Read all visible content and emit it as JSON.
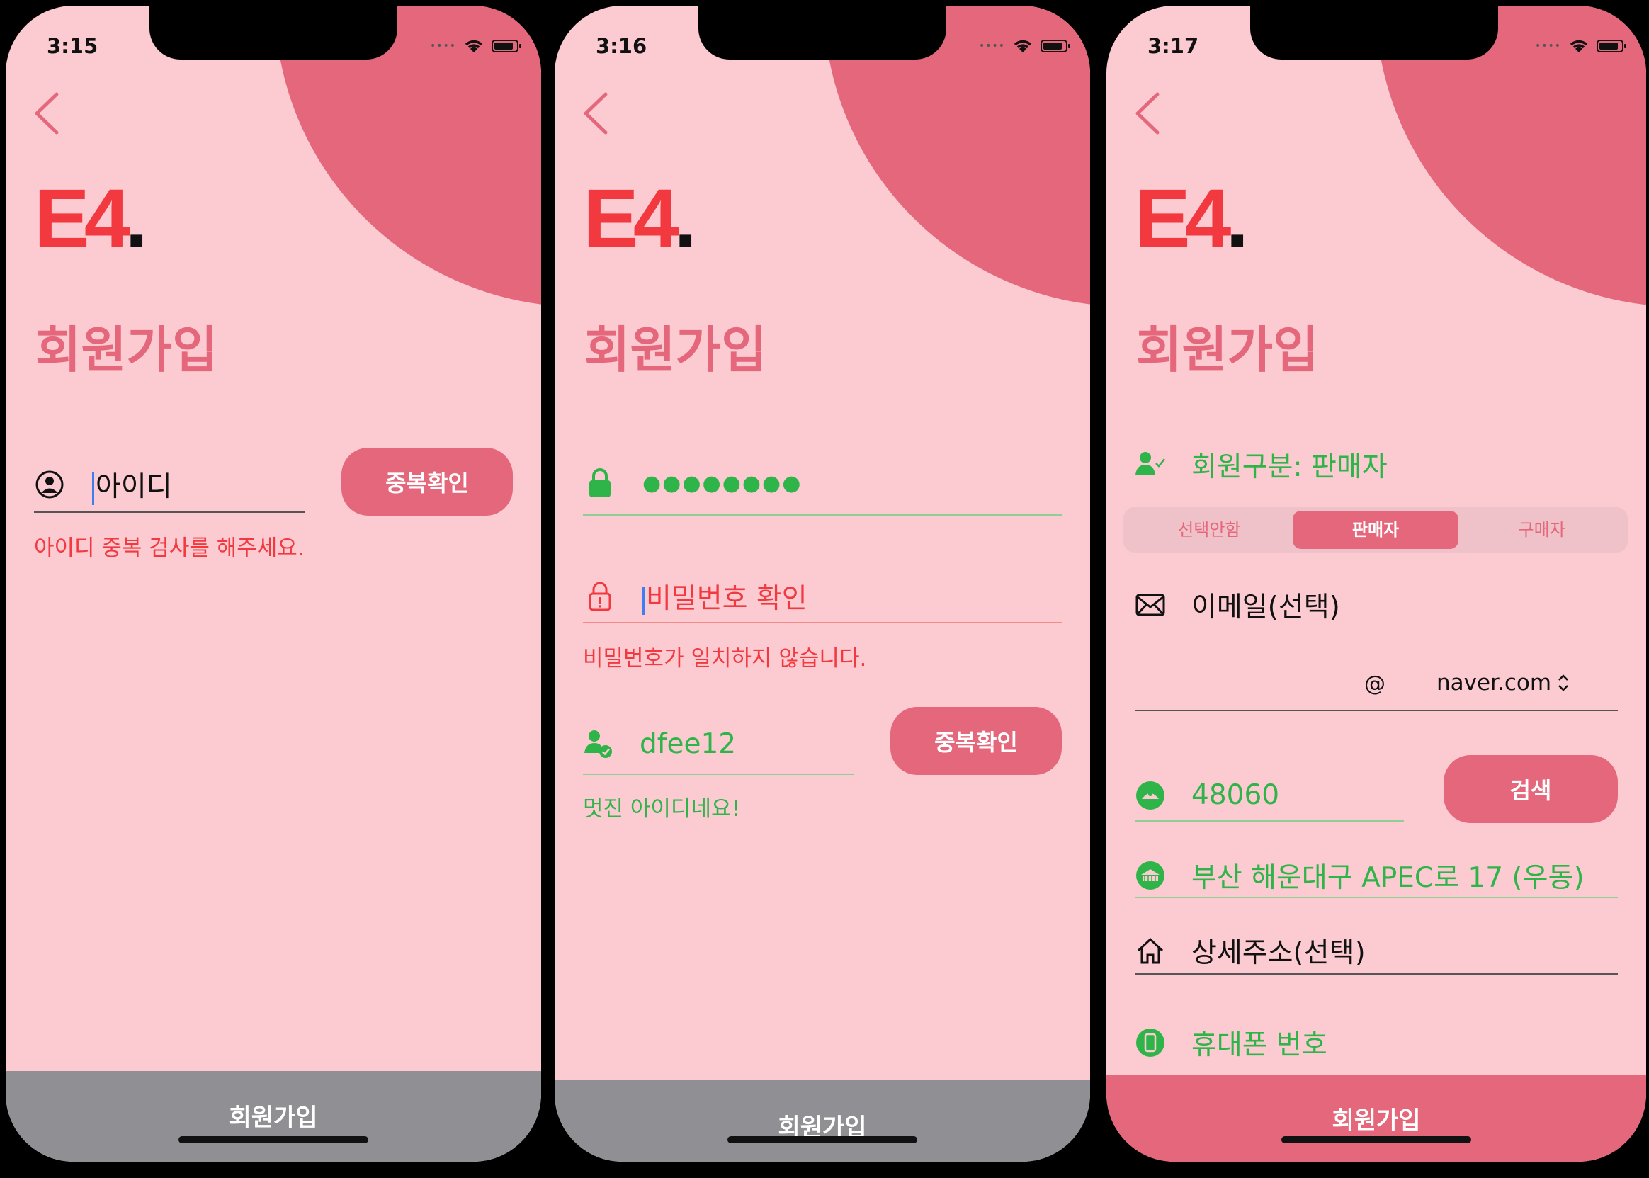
{
  "colors": {
    "accent": "#e5677c",
    "background": "#fbcbd1",
    "error": "#f2393f",
    "success": "#2fb44a",
    "disabled_bar": "#909094"
  },
  "logo": {
    "main": "E4",
    "dot": "."
  },
  "screens": [
    {
      "time": "3:15",
      "title": "회원가입",
      "id_field": {
        "placeholder": "아이디"
      },
      "dup_button": "중복확인",
      "message": "아이디 중복 검사를 해주세요.",
      "submit": "회원가입"
    },
    {
      "time": "3:16",
      "title": "회원가입",
      "password_field": {
        "value": "●●●●●●●●"
      },
      "password_confirm": {
        "placeholder": "비밀번호 확인"
      },
      "mismatch_message": "비밀번호가 일치하지 않습니다.",
      "id_field": {
        "value": "dfee12"
      },
      "dup_button": "중복확인",
      "success_message": "멋진 아이디네요!",
      "submit": "회원가입"
    },
    {
      "time": "3:17",
      "title": "회원가입",
      "member_type_label": "회원구분: 판매자",
      "segments": [
        "선택안함",
        "판매자",
        "구매자"
      ],
      "email": {
        "placeholder": "이메일(선택)",
        "at": "@",
        "domain": "naver.com"
      },
      "zip": {
        "value": "48060"
      },
      "search_button": "검색",
      "address": "부산 해운대구 APEC로 17 (우동)",
      "detail_address": {
        "placeholder": "상세주소(선택)"
      },
      "phone": {
        "placeholder": "휴대폰 번호"
      },
      "submit": "회원가입"
    }
  ]
}
